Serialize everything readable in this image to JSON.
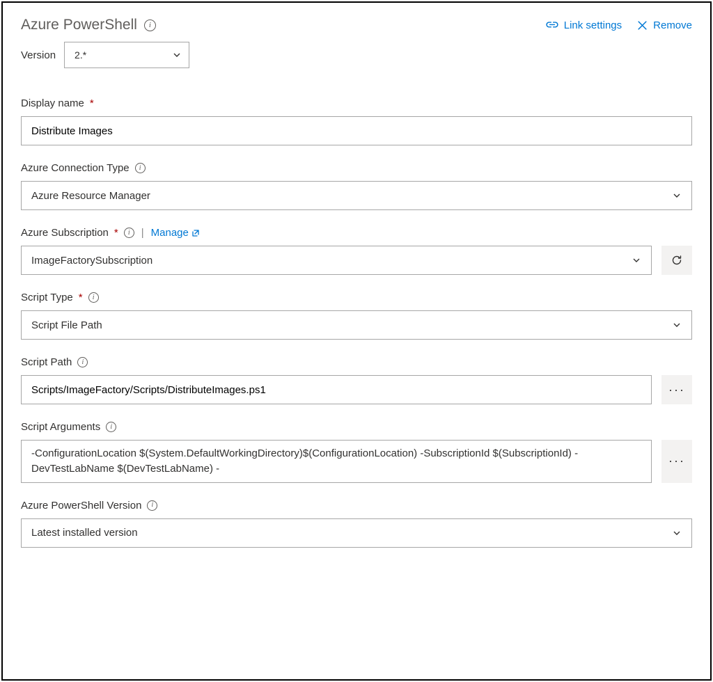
{
  "header": {
    "title": "Azure PowerShell",
    "link_settings_label": "Link settings",
    "remove_label": "Remove"
  },
  "version": {
    "label": "Version",
    "value": "2.*"
  },
  "fields": {
    "display_name": {
      "label": "Display name",
      "value": "Distribute Images"
    },
    "connection_type": {
      "label": "Azure Connection Type",
      "value": "Azure Resource Manager"
    },
    "subscription": {
      "label": "Azure Subscription",
      "manage_label": "Manage",
      "value": "ImageFactorySubscription"
    },
    "script_type": {
      "label": "Script Type",
      "value": "Script File Path"
    },
    "script_path": {
      "label": "Script Path",
      "value": "Scripts/ImageFactory/Scripts/DistributeImages.ps1"
    },
    "script_args": {
      "label": "Script Arguments",
      "value": " -ConfigurationLocation $(System.DefaultWorkingDirectory)$(ConfigurationLocation) -SubscriptionId $(SubscriptionId) -DevTestLabName $(DevTestLabName) -"
    },
    "ps_version": {
      "label": "Azure PowerShell Version",
      "value": "Latest installed version"
    }
  },
  "aux": {
    "ellipsis": "···"
  }
}
